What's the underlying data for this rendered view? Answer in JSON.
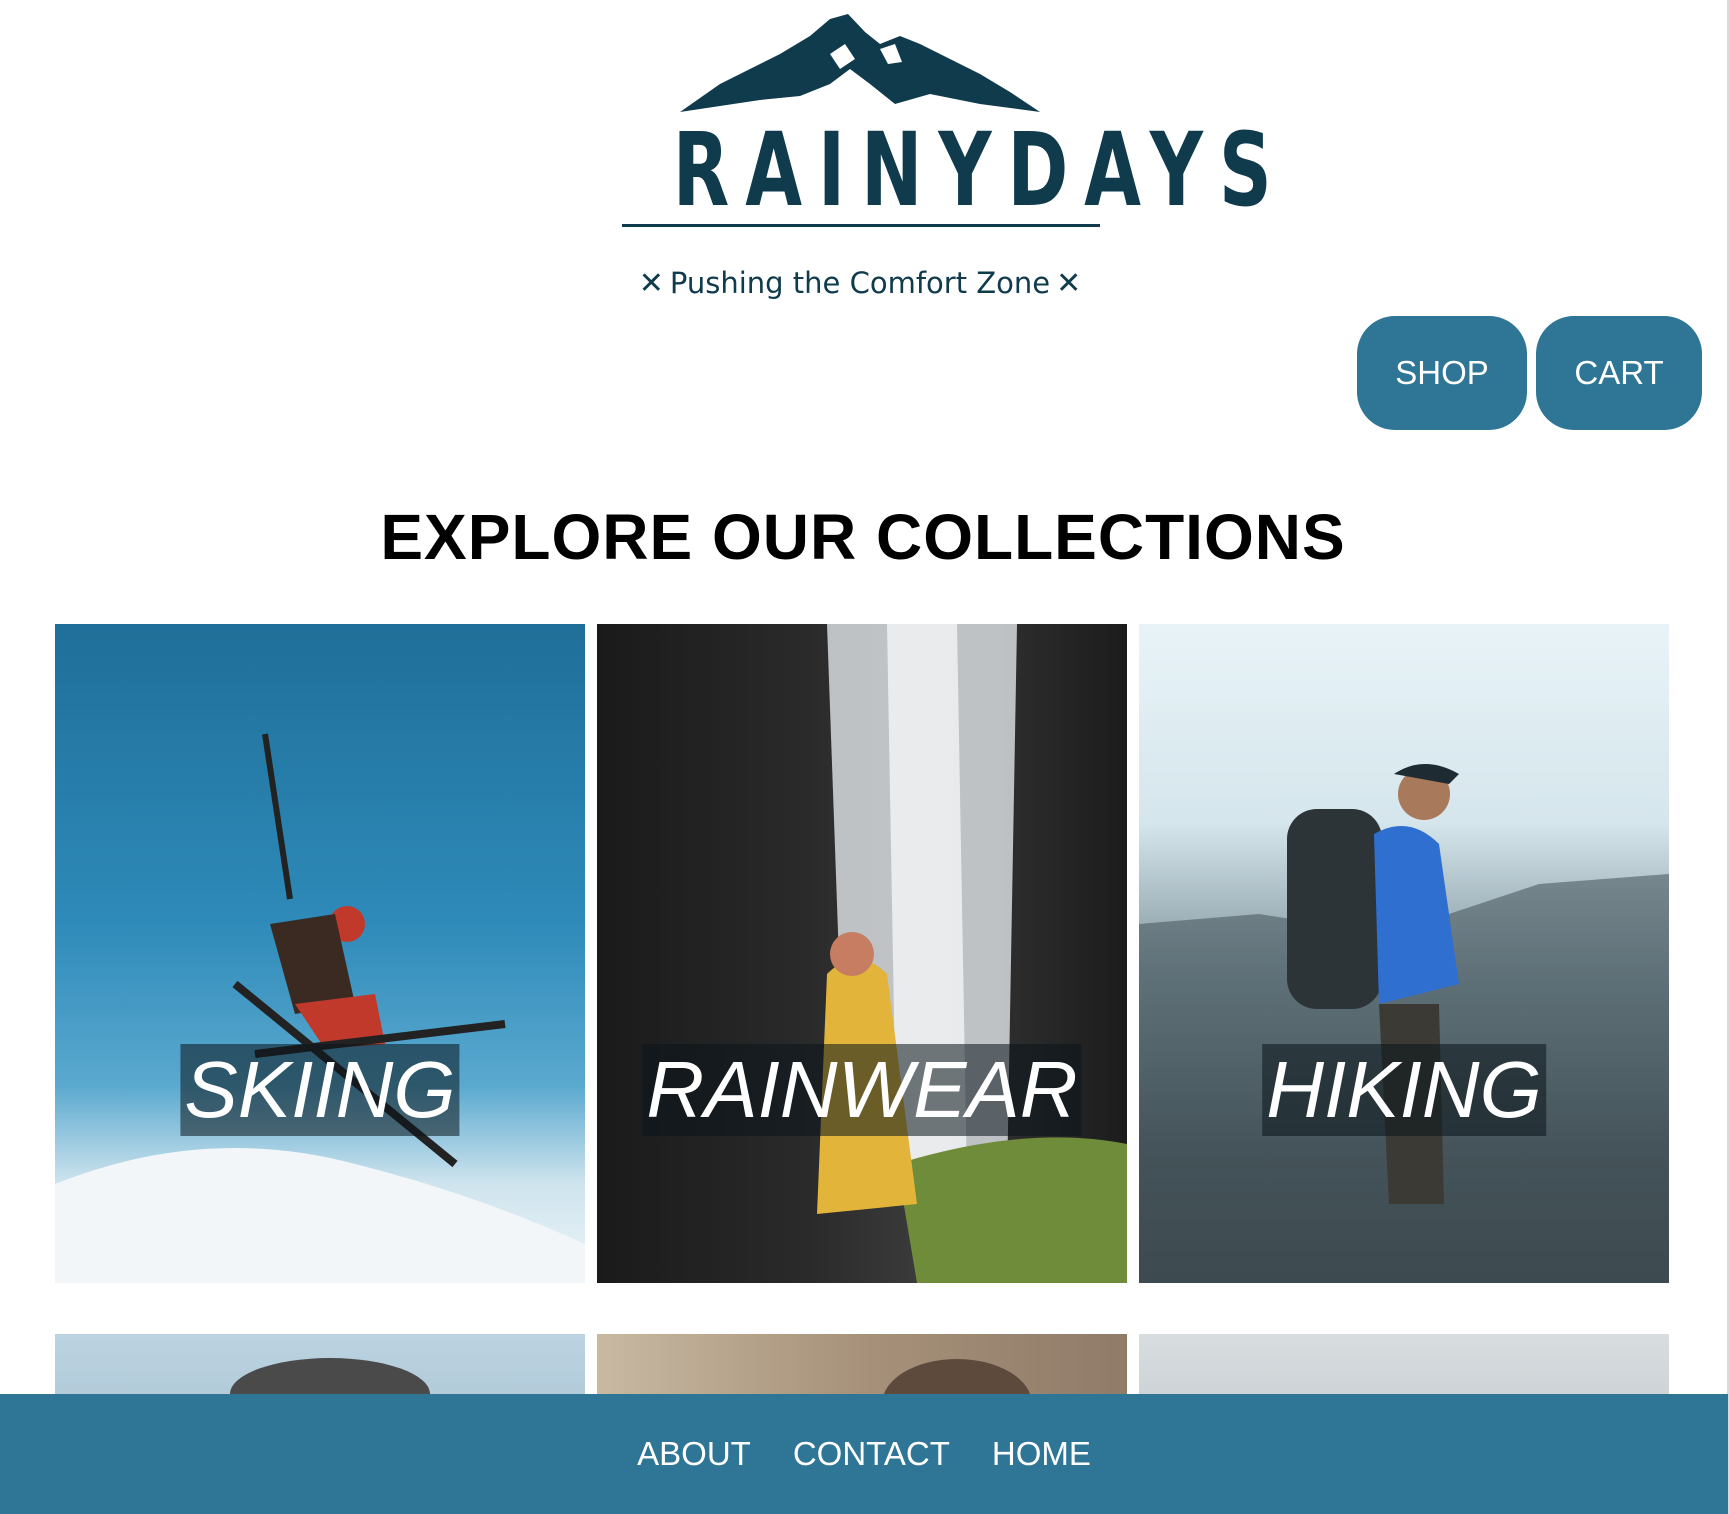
{
  "brand": {
    "name": "RAINYDAYS",
    "tagline": "Pushing the Comfort Zone",
    "primary_color": "#2e7596",
    "logo_color": "#0f3b4d"
  },
  "header": {
    "buttons": [
      {
        "label": "SHOP"
      },
      {
        "label": "CART"
      }
    ]
  },
  "main": {
    "heading": "EXPLORE OUR COLLECTIONS",
    "collections": [
      {
        "label": "SKIING"
      },
      {
        "label": "RAINWEAR"
      },
      {
        "label": "HIKING"
      }
    ]
  },
  "footer": {
    "links": [
      {
        "label": "ABOUT"
      },
      {
        "label": "CONTACT"
      },
      {
        "label": "HOME"
      }
    ]
  }
}
